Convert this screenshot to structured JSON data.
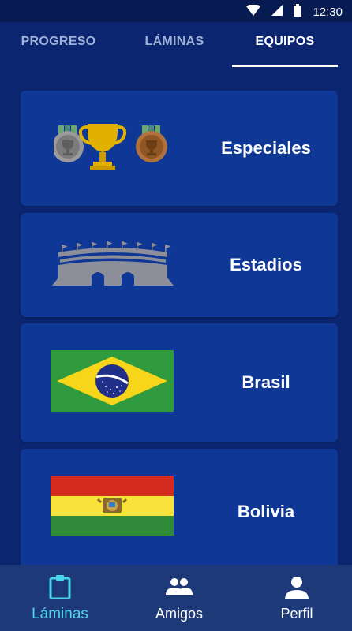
{
  "status_bar": {
    "time": "12:30",
    "icons": [
      "wifi-icon",
      "signal-icon",
      "battery-icon"
    ]
  },
  "tabs": [
    {
      "label": "PROGRESO",
      "active": false
    },
    {
      "label": "LÁMINAS",
      "active": false
    },
    {
      "label": "EQUIPOS",
      "active": true
    }
  ],
  "cards": [
    {
      "label": "Especiales",
      "image": "trophy-medals-icon"
    },
    {
      "label": "Estadios",
      "image": "stadium-icon"
    },
    {
      "label": "Brasil",
      "image": "brazil-flag"
    },
    {
      "label": "Bolivia",
      "image": "bolivia-flag"
    }
  ],
  "bottom_nav": [
    {
      "label": "Láminas",
      "icon": "clipboard-icon",
      "active": true
    },
    {
      "label": "Amigos",
      "icon": "people-icon",
      "active": false
    },
    {
      "label": "Perfil",
      "icon": "person-icon",
      "active": false
    }
  ],
  "colors": {
    "background": "#0b2570",
    "card": "#0e3796",
    "bottom_nav": "#1e3977",
    "accent": "#48d8ee"
  }
}
